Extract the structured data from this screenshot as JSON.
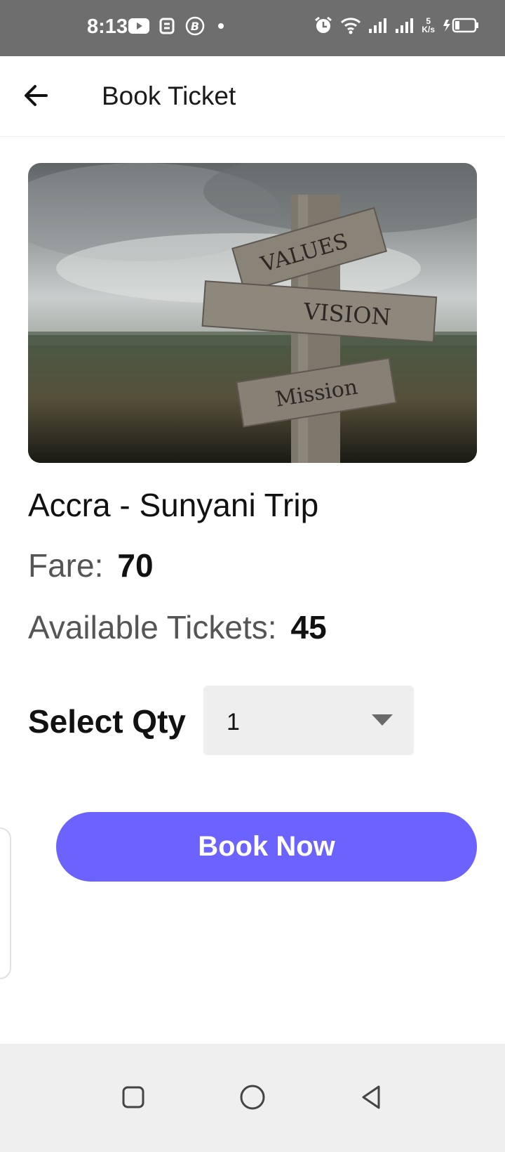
{
  "status_bar": {
    "time": "8:13",
    "net_speed_value": "5",
    "net_speed_unit": "K/s",
    "icons": [
      "youtube-icon",
      "app-icon",
      "bitcoin-icon",
      "dot-icon",
      "alarm-icon",
      "wifi-icon",
      "signal-icon",
      "signal-icon",
      "battery-charging-icon"
    ]
  },
  "app_bar": {
    "back_icon": "arrow-left-icon",
    "title": "Book Ticket"
  },
  "trip": {
    "image_sign_1": "VALUES",
    "image_sign_2": "VISION",
    "image_sign_3": "Mission",
    "name": "Accra - Sunyani Trip",
    "fare_label": "Fare:",
    "fare_value": "70",
    "tickets_label": "Available Tickets:",
    "tickets_value": "45"
  },
  "quantity": {
    "label": "Select Qty",
    "selected": "1"
  },
  "actions": {
    "book_label": "Book Now"
  },
  "colors": {
    "accent": "#6c63ff",
    "status_bar": "#6e6e6e",
    "nav_bar": "#efefef",
    "select_bg": "#eeeeee"
  },
  "nav_bar": {
    "icons": [
      "square-icon",
      "circle-icon",
      "triangle-back-icon"
    ]
  }
}
